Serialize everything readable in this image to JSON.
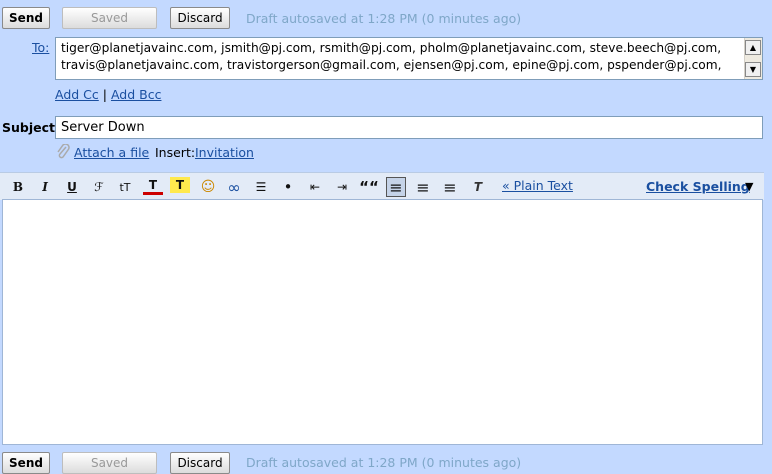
{
  "top_bar": {
    "send_label": "Send",
    "saved_label": "Saved",
    "discard_label": "Discard",
    "autosave_text": "Draft autosaved at 1:28 PM (0 minutes ago)"
  },
  "to": {
    "label": "To:",
    "value": "tiger@planetjavainc.com, jsmith@pj.com, rsmith@pj.com, pholm@planetjavainc.com, steve.beech@pj.com, travis@planetjavainc.com, travistorgerson@gmail.com, ejensen@pj.com, epine@pj.com, pspender@pj.com,"
  },
  "cc_links": {
    "add_cc": "Add Cc",
    "separator": "|",
    "add_bcc": "Add Bcc"
  },
  "subject": {
    "label": "Subject:",
    "value": "Server Down"
  },
  "attach": {
    "attach_label": "Attach a file",
    "insert_label": "Insert:",
    "invitation_label": "Invitation"
  },
  "toolbar": {
    "bold": "B",
    "italic": "I",
    "underline": "U",
    "font": "ℱ",
    "size": "tT",
    "text_color": "T",
    "highlight": "T",
    "smiley": "☺",
    "link": "∞",
    "numbered": "☰",
    "bulleted": "•",
    "outdent": "⇤",
    "indent": "⇥",
    "quote": "““",
    "align_left": "≡",
    "align_center": "≡",
    "align_right": "≡",
    "remove_format": "T",
    "plain_text": "« Plain Text",
    "check_spelling": "Check Spelling",
    "check_spelling_arrow": "▼"
  },
  "bottom_bar": {
    "send_label": "Send",
    "saved_label": "Saved",
    "discard_label": "Discard",
    "autosave_text": "Draft autosaved at 1:28 PM (0 minutes ago)"
  },
  "colors": {
    "background": "#c3d9ff",
    "link": "#1a4fa0",
    "autosave": "#7fa7c8",
    "toolbar": "#e3ebf7"
  }
}
